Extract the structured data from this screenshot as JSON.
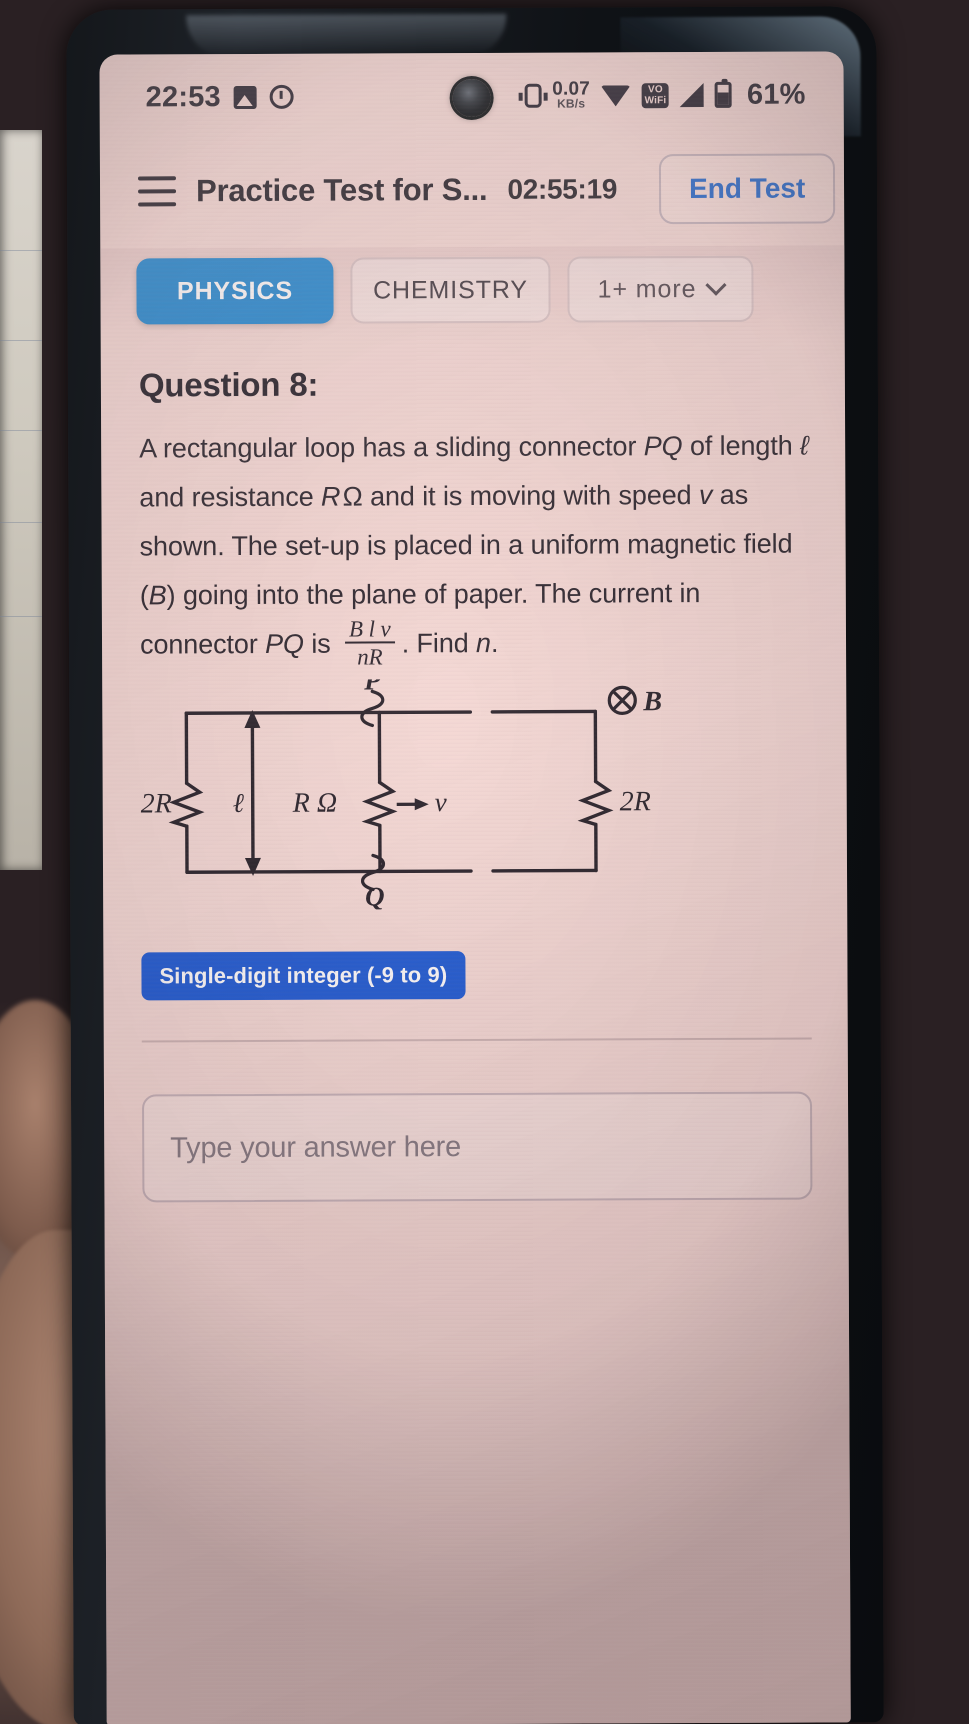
{
  "status_bar": {
    "time": "22:53",
    "icons_left": [
      "gallery-icon",
      "clock-icon"
    ],
    "network_rate_value": "0.07",
    "network_rate_unit": "KB/s",
    "icons_right": [
      "vibrate-icon",
      "wifi-icon",
      "vowifi-icon",
      "signal-icon",
      "battery-icon"
    ],
    "vowifi_label": "VO\nWiFi",
    "battery_percent": "61%"
  },
  "header": {
    "menu_icon": "hamburger-menu-icon",
    "title": "Practice Test for S...",
    "timer": "02:55:19",
    "end_test_label": "End Test"
  },
  "tabs": [
    {
      "label": "PHYSICS",
      "active": true
    },
    {
      "label": "CHEMISTRY",
      "active": false
    },
    {
      "label": "1+ more",
      "active": false,
      "chevron": "chevron-down-icon"
    }
  ],
  "question": {
    "number_label": "Question 8:",
    "text_part_1": "A rectangular loop has a sliding connector ",
    "pq_1": "PQ",
    "text_part_2": " of length ",
    "ell_1": "ℓ",
    "text_part_3": " and resistance ",
    "r_sym": "R",
    "ohm_sym": "Ω",
    "text_part_4": " and it is moving with speed ",
    "v_sym": "v",
    "text_part_5": " as shown. The set-up is placed in a uniform magnetic field (",
    "b_sym": "B",
    "text_part_6": ") going into the plane of paper. The current in connector ",
    "pq_2": "PQ",
    "text_part_7": " is ",
    "fraction_numerator": "B l v",
    "fraction_denominator": "nR",
    "text_part_8": ". Find ",
    "n_sym": "n",
    "text_part_9": "."
  },
  "diagram": {
    "label_p": "P",
    "label_q": "Q",
    "label_b": "B",
    "b_symbol": "⊗",
    "label_left_resistor": "2R",
    "label_middle_resistor": "R Ω",
    "label_right_resistor": "2R",
    "label_length": "ℓ",
    "label_velocity": "v",
    "velocity_arrow": "→"
  },
  "answer": {
    "type_badge": "Single-digit integer (-9 to 9)",
    "input_placeholder": "Type your answer here",
    "input_value": ""
  },
  "colors": {
    "accent_blue": "#2f8fd6",
    "badge_blue": "#2a62d8",
    "link_blue": "#2f6fd0",
    "screen_bg": "#f6ddd9",
    "text": "#332c34"
  }
}
